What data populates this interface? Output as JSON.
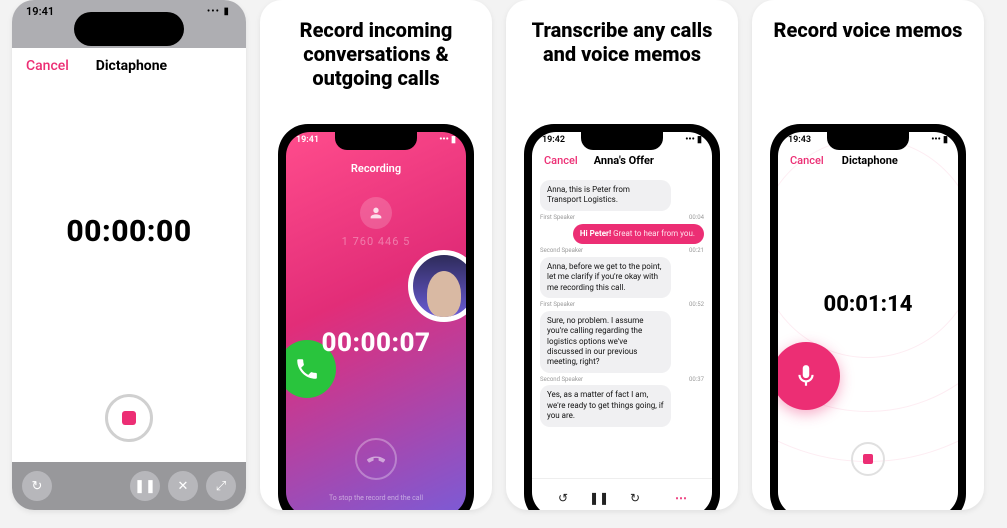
{
  "card1": {
    "status_time": "19:41",
    "cancel": "Cancel",
    "title": "Dictaphone",
    "timer": "00:00:00"
  },
  "promo2": {
    "headline": "Record incoming conversations & outgoing calls",
    "status_time": "19:41",
    "recording_label": "Recording",
    "number_dim": "1 760 446 5",
    "timer": "00:00:07",
    "hint": "To stop the record end the call"
  },
  "promo3": {
    "headline": "Transcribe any calls and voice memos",
    "status_time": "19:42",
    "cancel": "Cancel",
    "title": "Anna's Offer",
    "messages": [
      {
        "speaker": "",
        "time": "",
        "side": "grey",
        "text": "Anna, this is Peter from Transport Logistics."
      },
      {
        "speaker": "First Speaker",
        "time": "00:04",
        "side": "label"
      },
      {
        "speaker": "",
        "time": "",
        "side": "pink",
        "text_bold": "Hi Peter!",
        "text_rest": " Great to hear from you."
      },
      {
        "speaker": "Second Speaker",
        "time": "00:21",
        "side": "label"
      },
      {
        "speaker": "",
        "time": "",
        "side": "grey",
        "text": "Anna, before we get to the point, let me clarify if you're okay with me recording this call."
      },
      {
        "speaker": "First Speaker",
        "time": "00:52",
        "side": "label"
      },
      {
        "speaker": "",
        "time": "",
        "side": "grey",
        "text": "Sure, no problem. I assume you're calling regarding the logistics options we've discussed in our previous meeting, right?"
      },
      {
        "speaker": "Second Speaker",
        "time": "00:37",
        "side": "label"
      },
      {
        "speaker": "",
        "time": "",
        "side": "grey",
        "text": "Yes, as a matter of fact I am, we're ready to get things going, if you are."
      }
    ]
  },
  "promo4": {
    "headline": "Record voice memos",
    "status_time": "19:43",
    "cancel": "Cancel",
    "title": "Dictaphone",
    "timer": "00:01:14"
  }
}
